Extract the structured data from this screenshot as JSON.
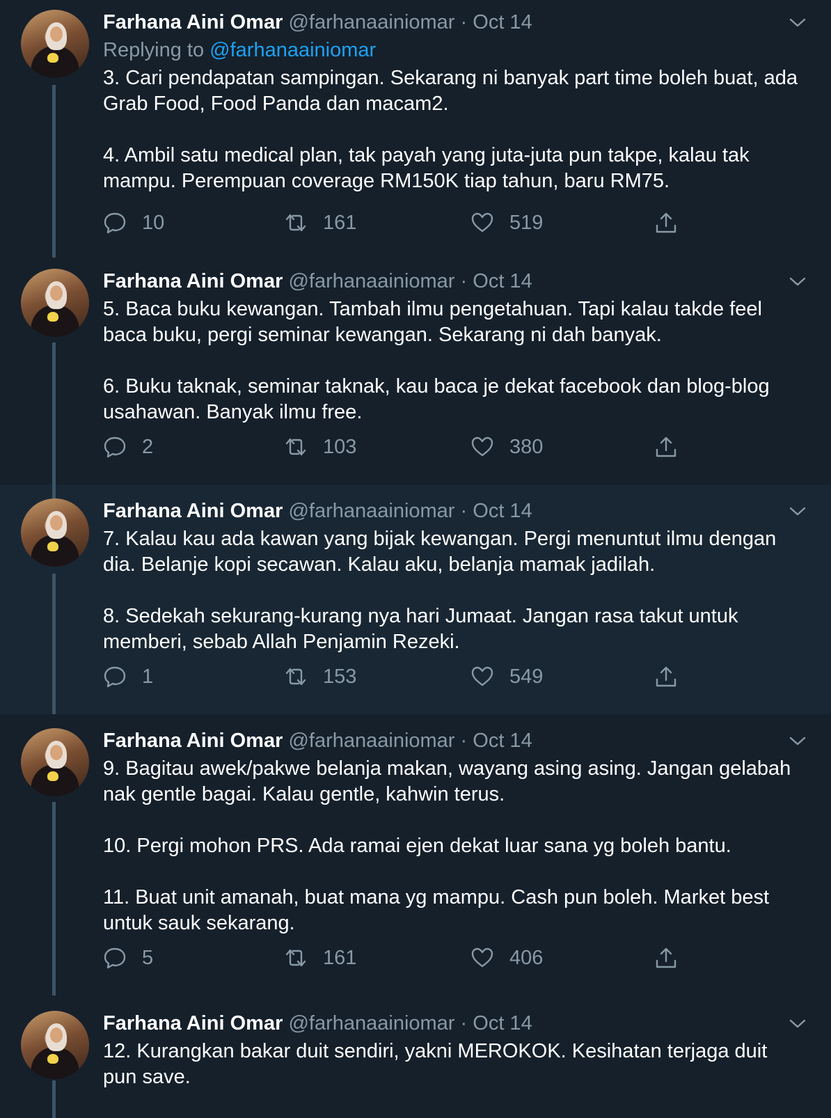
{
  "colors": {
    "background": "#15202b",
    "highlight_background": "#192734",
    "text": "#ffffff",
    "secondary_text": "#8899a6",
    "link": "#1da1f2",
    "thread_line": "#3d5466"
  },
  "icons": {
    "reply": "reply-icon",
    "retweet": "retweet-icon",
    "like": "heart-icon",
    "share": "share-icon",
    "menu": "chevron-down-icon"
  },
  "tweets": [
    {
      "name": "Farhana Aini Omar",
      "handle": "@farhanaainiomar",
      "separator": "·",
      "date": "Oct 14",
      "replying_to_label": "Replying to",
      "replying_to_handle": "@farhanaainiomar",
      "paragraphs": [
        "3. Cari pendapatan sampingan. Sekarang ni banyak part time boleh buat, ada Grab Food, Food Panda dan macam2.",
        "4. Ambil satu medical plan, tak payah yang juta-juta pun takpe, kalau tak mampu. Perempuan coverage RM150K tiap tahun, baru RM75."
      ],
      "replies": "10",
      "retweets": "161",
      "likes": "519"
    },
    {
      "name": "Farhana Aini Omar",
      "handle": "@farhanaainiomar",
      "separator": "·",
      "date": "Oct 14",
      "paragraphs": [
        "5. Baca buku kewangan. Tambah ilmu pengetahuan. Tapi kalau takde feel baca buku, pergi seminar kewangan. Sekarang ni dah banyak.",
        "6. Buku taknak, seminar taknak, kau baca je dekat facebook dan blog-blog usahawan. Banyak ilmu free."
      ],
      "replies": "2",
      "retweets": "103",
      "likes": "380"
    },
    {
      "name": "Farhana Aini Omar",
      "handle": "@farhanaainiomar",
      "separator": "·",
      "date": "Oct 14",
      "paragraphs": [
        "7. Kalau kau ada kawan yang bijak kewangan. Pergi menuntut ilmu dengan dia. Belanje kopi secawan. Kalau aku, belanja mamak jadilah.",
        "8. Sedekah sekurang-kurang nya hari Jumaat. Jangan rasa takut untuk memberi, sebab Allah Penjamin Rezeki."
      ],
      "replies": "1",
      "retweets": "153",
      "likes": "549"
    },
    {
      "name": "Farhana Aini Omar",
      "handle": "@farhanaainiomar",
      "separator": "·",
      "date": "Oct 14",
      "paragraphs": [
        "9. Bagitau awek/pakwe belanja makan, wayang asing asing. Jangan gelabah nak gentle bagai. Kalau gentle, kahwin terus.",
        "10. Pergi mohon PRS. Ada ramai ejen dekat luar sana yg boleh bantu.",
        "11. Buat unit amanah, buat mana yg mampu. Cash pun boleh. Market best untuk sauk sekarang."
      ],
      "replies": "5",
      "retweets": "161",
      "likes": "406"
    },
    {
      "name": "Farhana Aini Omar",
      "handle": "@farhanaainiomar",
      "separator": "·",
      "date": "Oct 14",
      "paragraphs": [
        "12. Kurangkan bakar duit sendiri, yakni MEROKOK. Kesihatan terjaga duit pun save."
      ]
    }
  ]
}
